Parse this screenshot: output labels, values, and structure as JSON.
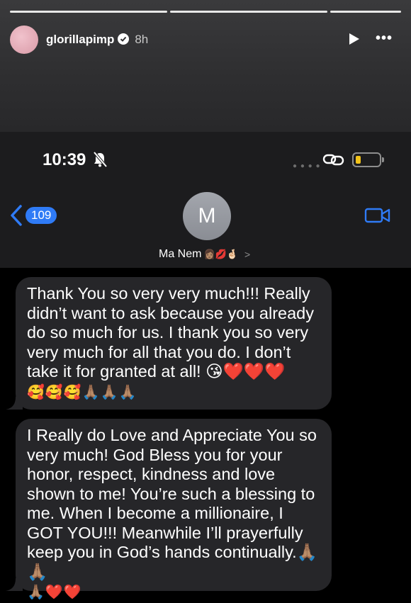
{
  "story": {
    "username": "glorillapimp",
    "time_ago": "8h"
  },
  "status_bar": {
    "time": "10:39"
  },
  "conversation": {
    "back_count": "109",
    "contact_initial": "M",
    "contact_name": "Ma Nem",
    "contact_emojis": "👩🏽💋🤞🏻"
  },
  "messages": [
    {
      "text": "Thank You so very very much!!! Really didn’t want to ask because you already do so much for us. I thank you so very very much for all that you do. I don’t take it for granted at all! 😘❤️❤️❤️",
      "emoji_line": "🥰🥰🥰🙏🏽🙏🏽🙏🏽"
    },
    {
      "text": "I Really do Love and Appreciate You so very much! God Bless you for your honor, respect, kindness and love shown to me! You’re such a blessing to me. When I become a millionaire, I GOT YOU!!! Meanwhile I’ll prayerfully keep you in God’s hands continually.🙏🏽🙏🏽",
      "emoji_line": "🙏🏽❤️❤️"
    }
  ],
  "colors": {
    "imessage_blue": "#2f7bf6",
    "bubble_gray": "#262629",
    "battery_yellow": "#f2c31a"
  }
}
